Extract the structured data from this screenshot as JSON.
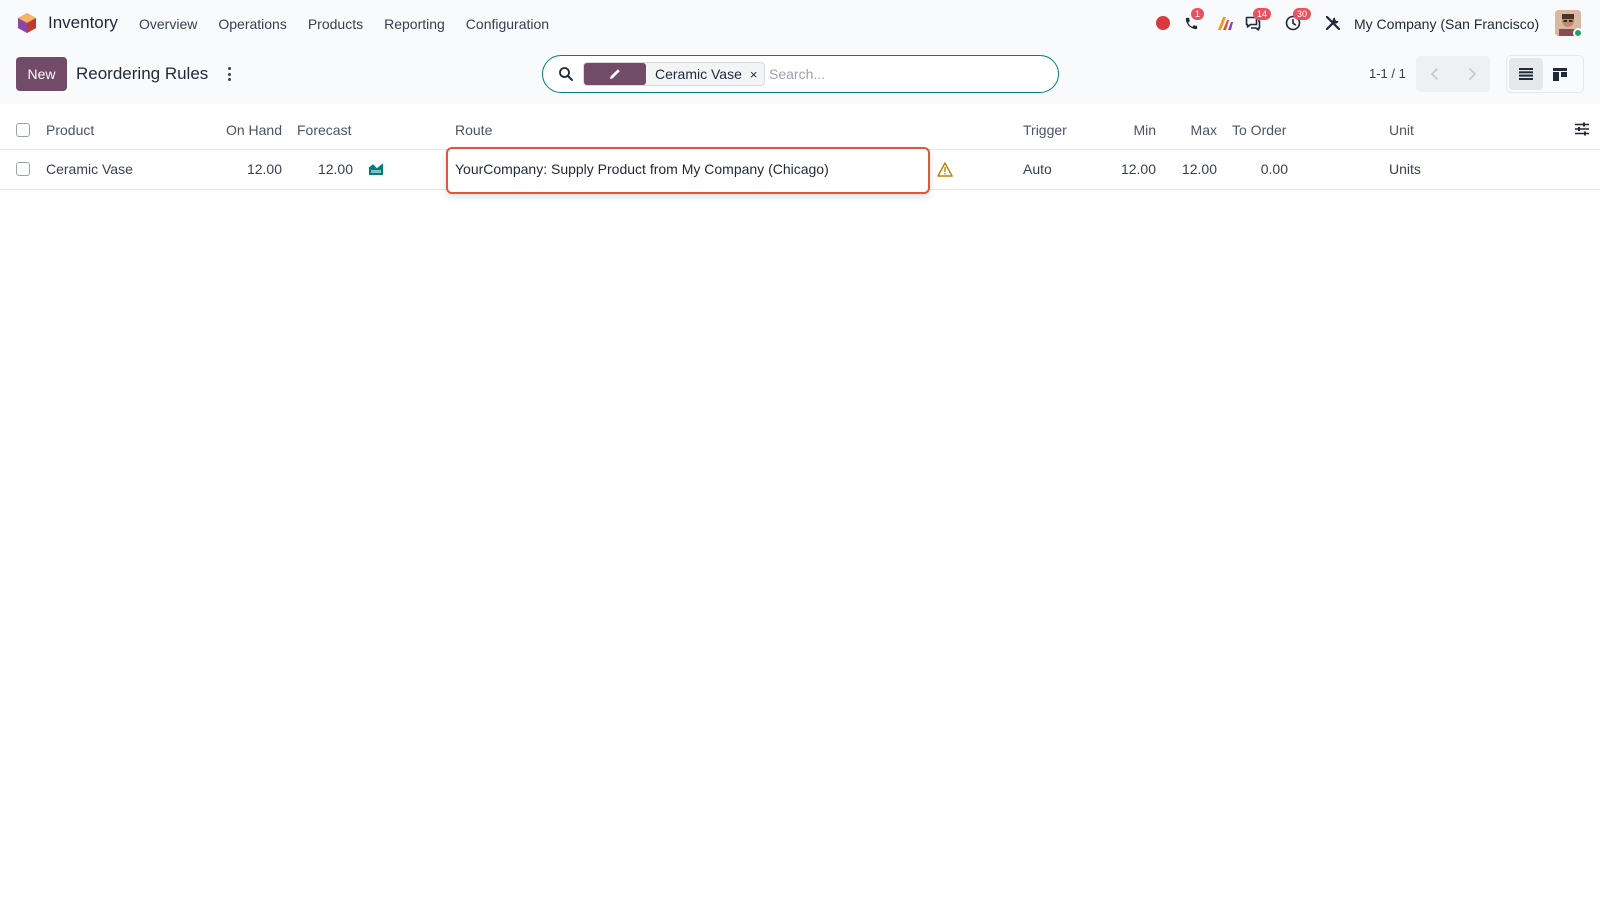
{
  "navbar": {
    "app_name": "Inventory",
    "menu": [
      "Overview",
      "Operations",
      "Products",
      "Reporting",
      "Configuration"
    ],
    "badges": {
      "phone": "1",
      "messages": "14",
      "activities": "30"
    },
    "company": "My Company (San Francisco)",
    "status_color": "#d9393e",
    "accent_color": "#714b67"
  },
  "control": {
    "new_label": "New",
    "title": "Reordering Rules",
    "search": {
      "facet_label": "Ceramic Vase",
      "facet_remove": "×",
      "placeholder": "Search..."
    },
    "pager": "1-1 / 1"
  },
  "table": {
    "headers": {
      "product": "Product",
      "on_hand": "On Hand",
      "forecast": "Forecast",
      "route": "Route",
      "trigger": "Trigger",
      "min": "Min",
      "max": "Max",
      "to_order": "To Order",
      "unit": "Unit"
    },
    "rows": [
      {
        "product": "Ceramic Vase",
        "on_hand": "12.00",
        "forecast": "12.00",
        "route": "YourCompany: Supply Product from My Company (Chicago)",
        "trigger": "Auto",
        "min": "12.00",
        "max": "12.00",
        "to_order": "0.00",
        "unit": "Units"
      }
    ]
  }
}
